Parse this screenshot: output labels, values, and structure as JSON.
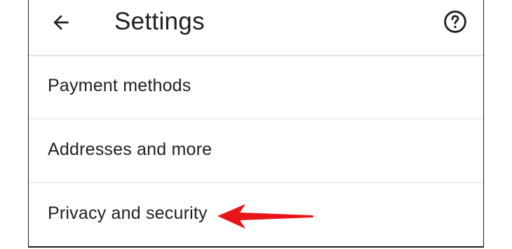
{
  "app_bar": {
    "title": "Settings",
    "back_icon": "arrow-left-icon",
    "help_icon": "help-circle-icon"
  },
  "settings_list": {
    "items": [
      {
        "label": "Payment methods"
      },
      {
        "label": "Addresses and more"
      },
      {
        "label": "Privacy and security"
      }
    ]
  },
  "annotation": {
    "type": "arrow",
    "color": "#e8141a",
    "points_to": "Privacy and security"
  },
  "colors": {
    "text": "#202124",
    "divider": "#dcdcdc",
    "background": "#ffffff"
  }
}
